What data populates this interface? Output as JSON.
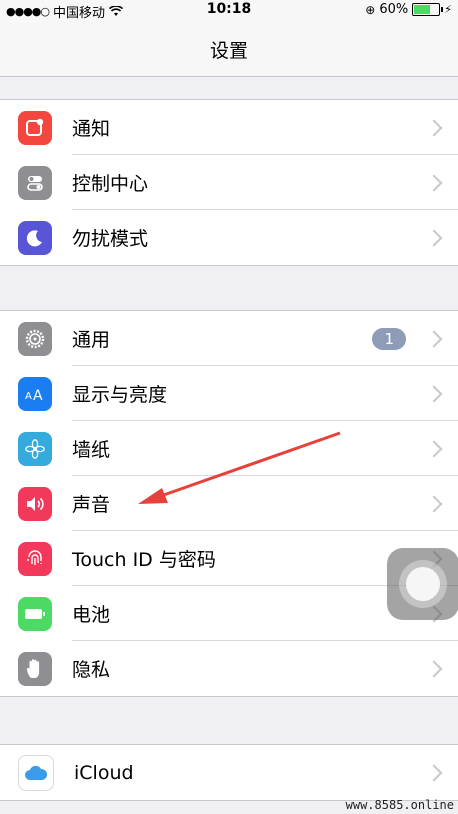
{
  "status_bar": {
    "signal": "●●●●○",
    "carrier": "中国移动",
    "time": "10:18",
    "battery_percent": "60%"
  },
  "navbar": {
    "title": "设置"
  },
  "groups": [
    {
      "items": [
        {
          "label": "通知",
          "icon": "notifications-icon",
          "color": "#f2463f"
        },
        {
          "label": "控制中心",
          "icon": "control-center-icon",
          "color": "#8e8e93"
        },
        {
          "label": "勿扰模式",
          "icon": "moon-icon",
          "color": "#5856d6"
        }
      ]
    },
    {
      "items": [
        {
          "label": "通用",
          "icon": "gear-icon",
          "color": "#8e8e93",
          "badge": "1"
        },
        {
          "label": "显示与亮度",
          "icon": "display-brightness-icon",
          "color": "#1a7ef0"
        },
        {
          "label": "墙纸",
          "icon": "wallpaper-icon",
          "color": "#35aadc"
        },
        {
          "label": "声音",
          "icon": "speaker-icon",
          "color": "#f2395b"
        },
        {
          "label": "Touch ID 与密码",
          "icon": "fingerprint-icon",
          "color": "#f2395b"
        },
        {
          "label": "电池",
          "icon": "battery-icon",
          "color": "#4cd964"
        },
        {
          "label": "隐私",
          "icon": "hand-icon",
          "color": "#8e8e93"
        }
      ]
    },
    {
      "items": [
        {
          "label": "iCloud",
          "icon": "icloud-icon",
          "color": "#ffffff"
        }
      ]
    }
  ],
  "watermark": "www.8585.online",
  "annotation": {
    "color": "#e8403a",
    "target": "声音"
  }
}
